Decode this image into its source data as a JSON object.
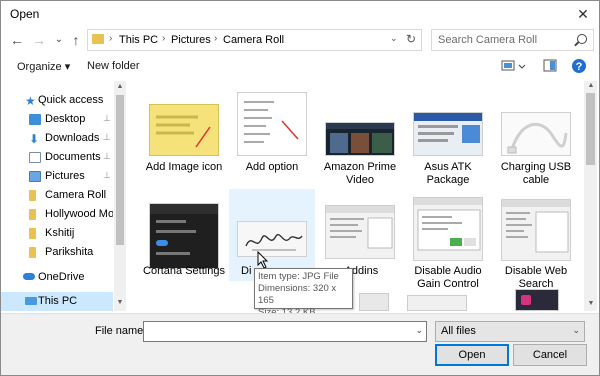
{
  "window": {
    "title": "Open",
    "close_label": "✕"
  },
  "nav": {
    "back_icon": "←",
    "forward_icon": "→",
    "recent_icon": "⌄",
    "up_icon": "↑",
    "breadcrumbs": [
      "This PC",
      "Pictures",
      "Camera Roll"
    ],
    "search_placeholder": "Search Camera Roll"
  },
  "toolbar": {
    "organize_label": "Organize ▾",
    "new_folder_label": "New folder",
    "help_label": "?"
  },
  "sidebar": {
    "items": [
      {
        "label": "Quick access",
        "icon": "star-icon",
        "pinned": false,
        "selected": false
      },
      {
        "label": "Desktop",
        "icon": "desktop-folder-icon",
        "pinned": true,
        "selected": false
      },
      {
        "label": "Downloads",
        "icon": "download-icon",
        "pinned": true,
        "selected": false
      },
      {
        "label": "Documents",
        "icon": "documents-icon",
        "pinned": true,
        "selected": false
      },
      {
        "label": "Pictures",
        "icon": "pictures-icon",
        "pinned": true,
        "selected": false
      },
      {
        "label": "Camera Roll",
        "icon": "folder-icon",
        "pinned": false,
        "selected": false
      },
      {
        "label": "Hollywood Movi",
        "icon": "folder-icon",
        "pinned": false,
        "selected": false
      },
      {
        "label": "Kshitij",
        "icon": "folder-icon",
        "pinned": false,
        "selected": false
      },
      {
        "label": "Parikshita",
        "icon": "folder-icon",
        "pinned": false,
        "selected": false
      },
      {
        "label": "OneDrive",
        "icon": "cloud-icon",
        "pinned": false,
        "selected": false
      },
      {
        "label": "This PC",
        "icon": "computer-icon",
        "pinned": false,
        "selected": true
      }
    ],
    "pin_glyph": "📌"
  },
  "files": {
    "row1": [
      {
        "label": "Add Image icon",
        "thumb": "yellow-note"
      },
      {
        "label": "Add option",
        "thumb": "menu-screenshot"
      },
      {
        "label": "Amazon Prime Video",
        "thumb": "video-dark"
      },
      {
        "label": "Asus ATK Package",
        "thumb": "blue-window"
      },
      {
        "label": "Charging USB cable",
        "thumb": "usb-cable"
      }
    ],
    "row2": [
      {
        "label": "Cortana Settings",
        "thumb": "dark-settings"
      },
      {
        "label": "Di",
        "thumb": "signature"
      },
      {
        "label": "e Addins",
        "thumb": "gray-dialog"
      },
      {
        "label": "Disable Audio Gain Control",
        "thumb": "gray-dialog"
      },
      {
        "label": "Disable Web Search",
        "thumb": "gray-dialog"
      }
    ]
  },
  "tooltip": {
    "type": "Item type: JPG File",
    "dimensions": "Dimensions: 320 x 165",
    "size": "Size: 13.2 KB"
  },
  "bottom": {
    "filename_label": "File name:",
    "filename_value": "",
    "filetype_value": "All files",
    "open_label": "Open",
    "cancel_label": "Cancel"
  },
  "colors": {
    "selection": "#cce8ff",
    "accent": "#0078d7",
    "folder": "#e9c253"
  }
}
